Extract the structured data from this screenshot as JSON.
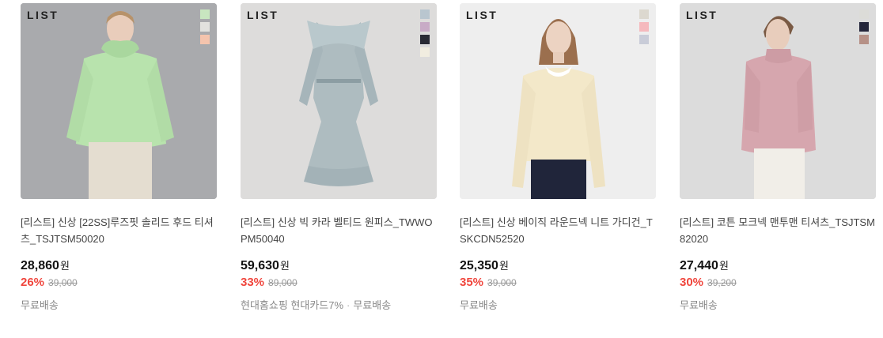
{
  "products": [
    {
      "brand": "LIST",
      "title": "[리스트] 신상 [22SS]루즈핏 솔리드 후드 티셔츠_TSJTSM50020",
      "price": "28,860",
      "currency": "원",
      "discount": "26%",
      "original_price": "39,000",
      "shipping": [
        "무료배송"
      ],
      "swatches": [
        "#c8e6c0",
        "#e2e2de",
        "#f4c4ad"
      ],
      "image_bg": "#a9aaad",
      "garment_color": "#b8e3ad"
    },
    {
      "brand": "LIST",
      "title": "[리스트] 신상 빅 카라 벨티드 원피스_TWWOPM50040",
      "price": "59,630",
      "currency": "원",
      "discount": "33%",
      "original_price": "89,000",
      "shipping": [
        "현대홈쇼핑 현대카드7%",
        "무료배송"
      ],
      "swatches": [
        "#b9c6cf",
        "#c8abc6",
        "#2a2b34",
        "#f1ede0"
      ],
      "image_bg": "#dddcdb",
      "garment_color": "#aebcc0"
    },
    {
      "brand": "LIST",
      "title": "[리스트] 신상 베이직 라운드넥 니트 가디건_TSKCDN52520",
      "price": "25,350",
      "currency": "원",
      "discount": "35%",
      "original_price": "39,000",
      "shipping": [
        "무료배송"
      ],
      "swatches": [
        "#dcd8cf",
        "#f5b9bd",
        "#c9ccd8"
      ],
      "image_bg": "#eeeeee",
      "garment_color": "#f3e8c9"
    },
    {
      "brand": "LIST",
      "title": "[리스트] 코튼 모크넥 맨투맨 티셔츠_TSJTSM82020",
      "price": "27,440",
      "currency": "원",
      "discount": "30%",
      "original_price": "39,200",
      "shipping": [
        "무료배송"
      ],
      "swatches": [
        "#dcdcd8",
        "#23253a",
        "#b69187"
      ],
      "image_bg": "#dcdcdc",
      "garment_color": "#d6a6ae"
    }
  ]
}
